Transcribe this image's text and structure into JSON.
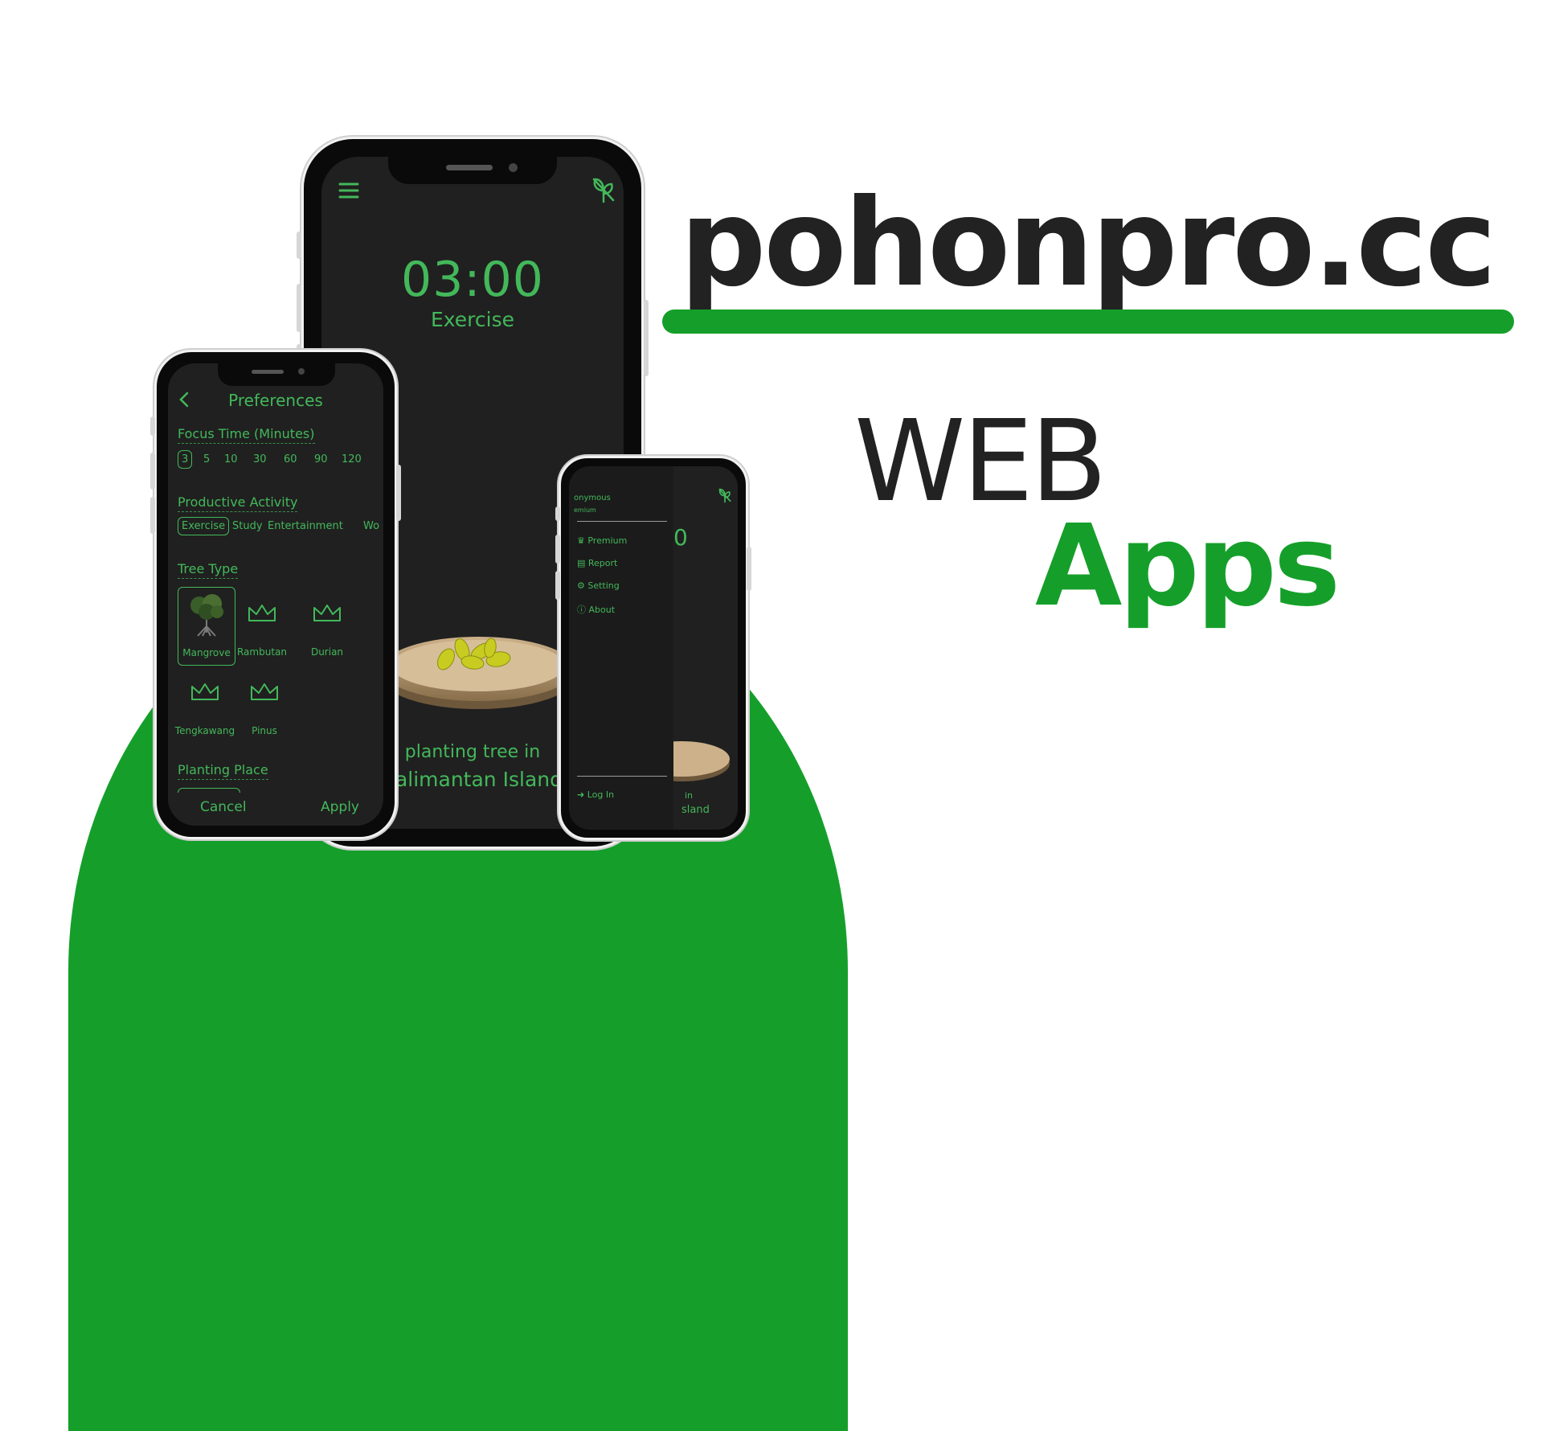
{
  "brand": {
    "site": "pohonpro.cc",
    "line1": "WEB",
    "line2": "Apps"
  },
  "main_phone": {
    "timer": "03:00",
    "activity": "Exercise",
    "planting_line1": "planting tree in",
    "planting_line2": "Kalimantan Island"
  },
  "prefs": {
    "title": "Preferences",
    "focus_label": "Focus Time (Minutes)",
    "focus_options": [
      "3",
      "5",
      "10",
      "30",
      "60",
      "90",
      "120"
    ],
    "activity_label": "Productive Activity",
    "activities": [
      "Exercise",
      "Study",
      "Entertainment",
      "Wo"
    ],
    "tree_label": "Tree Type",
    "trees": [
      "Mangrove",
      "Rambutan",
      "Durian",
      "Tengkawang",
      "Pinus"
    ],
    "place_label": "Planting Place",
    "cancel": "Cancel",
    "apply": "Apply"
  },
  "drawer": {
    "user_line1": "onymous",
    "user_line2": "emium",
    "items": [
      "Premium",
      "Report",
      "Setting",
      "About"
    ],
    "login": "Log In",
    "timer_fragment": "0",
    "caption_frag1": "in",
    "caption_frag2": "sland"
  },
  "colors": {
    "brand_green": "#159f2a",
    "app_green": "#43b85a",
    "screen_bg": "#202020",
    "ink": "#222222"
  }
}
